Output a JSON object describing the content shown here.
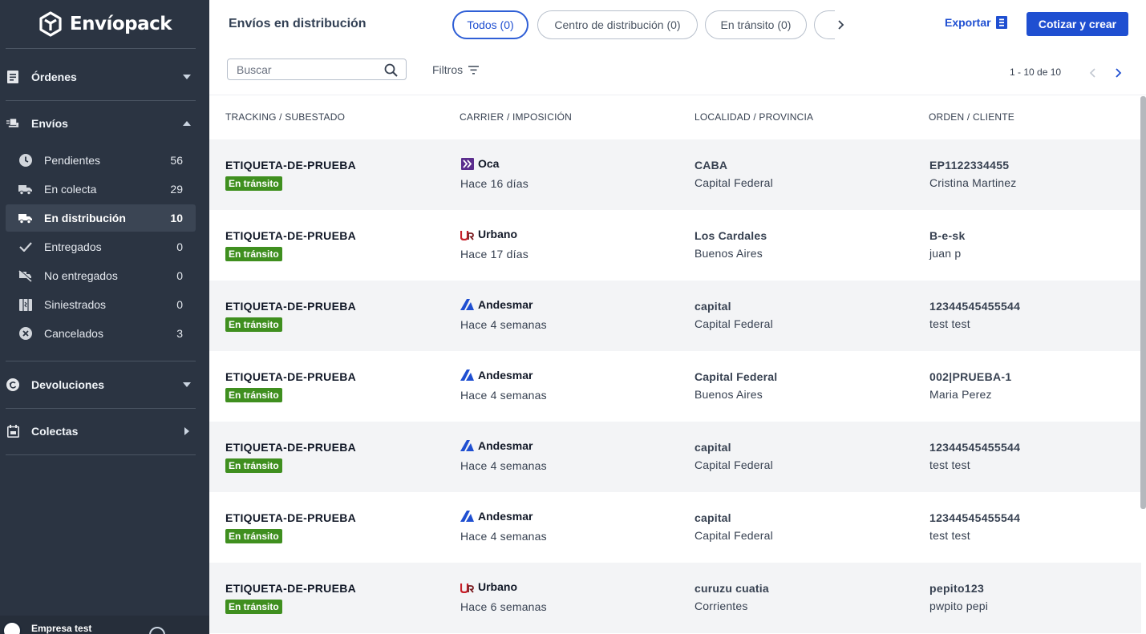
{
  "app": {
    "name": "Envíopack"
  },
  "sidebar": {
    "sections": {
      "ordenes": "Órdenes",
      "envios": "Envíos",
      "devoluciones": "Devoluciones",
      "colectas": "Colectas"
    },
    "envios_items": [
      {
        "label": "Pendientes",
        "count": "56",
        "icon": "clock-icon"
      },
      {
        "label": "En colecta",
        "count": "29",
        "icon": "truck-icon"
      },
      {
        "label": "En distribución",
        "count": "10",
        "icon": "delivery-truck-icon",
        "active": true
      },
      {
        "label": "Entregados",
        "count": "0",
        "icon": "check-icon"
      },
      {
        "label": "No entregados",
        "count": "0",
        "icon": "truck-crossed-icon"
      },
      {
        "label": "Siniestrados",
        "count": "0",
        "icon": "damaged-box-icon"
      },
      {
        "label": "Cancelados",
        "count": "3",
        "icon": "x-circle-icon"
      }
    ],
    "footer": {
      "company": "Empresa test"
    }
  },
  "header": {
    "title": "Envíos en distribución",
    "tabs": [
      {
        "label": "Todos (0)",
        "active": true
      },
      {
        "label": "Centro de distribución (0)"
      },
      {
        "label": "En tránsito (0)"
      }
    ],
    "export_label": "Exportar",
    "primary_label": "Cotizar y crear"
  },
  "toolbar": {
    "search_placeholder": "Buscar",
    "filters_label": "Filtros",
    "pagination": "1 - 10 de 10"
  },
  "table": {
    "columns": [
      "TRACKING / SUBESTADO",
      "CARRIER / IMPOSICIÓN",
      "LOCALIDAD / PROVINCIA",
      "ORDEN / CLIENTE"
    ],
    "rows": [
      {
        "tracking": "ETIQUETA-DE-PRUEBA",
        "status": "En tránsito",
        "carrier": "Oca",
        "since": "Hace 16 días",
        "locality": "CABA",
        "province": "Capital Federal",
        "order": "EP1122334455",
        "client": "Cristina Martinez"
      },
      {
        "tracking": "ETIQUETA-DE-PRUEBA",
        "status": "En tránsito",
        "carrier": "Urbano",
        "since": "Hace 17 días",
        "locality": "Los Cardales",
        "province": "Buenos Aires",
        "order": "B-e-sk",
        "client": "juan p"
      },
      {
        "tracking": "ETIQUETA-DE-PRUEBA",
        "status": "En tránsito",
        "carrier": "Andesmar",
        "since": "Hace 4 semanas",
        "locality": "capital",
        "province": "Capital Federal",
        "order": "12344545455544",
        "client": "test test"
      },
      {
        "tracking": "ETIQUETA-DE-PRUEBA",
        "status": "En tránsito",
        "carrier": "Andesmar",
        "since": "Hace 4 semanas",
        "locality": "Capital Federal",
        "province": "Buenos Aires",
        "order": "002|PRUEBA-1",
        "client": "Maria Perez"
      },
      {
        "tracking": "ETIQUETA-DE-PRUEBA",
        "status": "En tránsito",
        "carrier": "Andesmar",
        "since": "Hace 4 semanas",
        "locality": "capital",
        "province": "Capital Federal",
        "order": "12344545455544",
        "client": "test test"
      },
      {
        "tracking": "ETIQUETA-DE-PRUEBA",
        "status": "En tránsito",
        "carrier": "Andesmar",
        "since": "Hace 4 semanas",
        "locality": "capital",
        "province": "Capital Federal",
        "order": "12344545455544",
        "client": "test test"
      },
      {
        "tracking": "ETIQUETA-DE-PRUEBA",
        "status": "En tránsito",
        "carrier": "Urbano",
        "since": "Hace 6 semanas",
        "locality": "curuzu cuatia",
        "province": "Corrientes",
        "order": "pepito123",
        "client": "pwpito pepi"
      }
    ]
  },
  "colors": {
    "sidebar_bg": "#2b3442",
    "accent": "#1f4fd1",
    "status_green": "#3f8f1f",
    "oca_purple": "#5b2d8e",
    "urbano_red": "#c8202a",
    "andesmar_blue": "#1f4fd1"
  }
}
